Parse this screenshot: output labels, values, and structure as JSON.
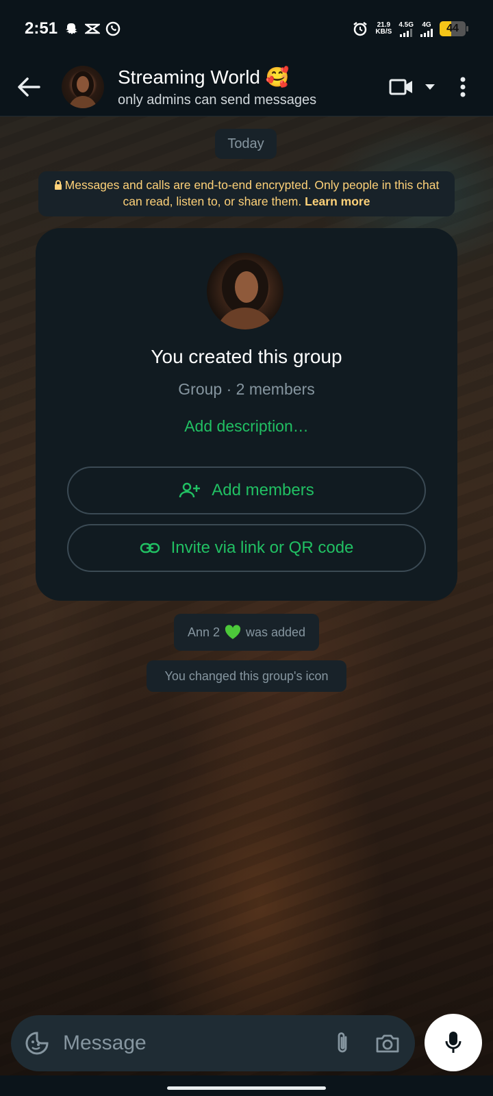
{
  "status_bar": {
    "time": "2:51",
    "speed_value": "21.9",
    "speed_unit": "KB/S",
    "net1": "4.5G",
    "net2": "4G",
    "battery_level": "44",
    "battery_fraction": 0.44
  },
  "header": {
    "title": "Streaming World 🥰",
    "subtitle": "only admins can send messages"
  },
  "chat": {
    "date_label": "Today",
    "encryption_notice": "Messages and calls are end-to-end encrypted. Only people in this chat can read, listen to, or share them.",
    "learn_more": "Learn more"
  },
  "group_card": {
    "title": "You created this group",
    "subtitle": "Group · 2 members",
    "add_description": "Add description…",
    "add_members": "Add members",
    "invite": "Invite via link or QR code"
  },
  "system_messages": {
    "added_name": "Ann 2",
    "added_suffix": "was added",
    "icon_changed": "You changed this group's icon"
  },
  "composer": {
    "placeholder": "Message"
  },
  "colors": {
    "accent_green": "#21c063",
    "notice_yellow": "#ffd279",
    "background": "#0b141a"
  }
}
